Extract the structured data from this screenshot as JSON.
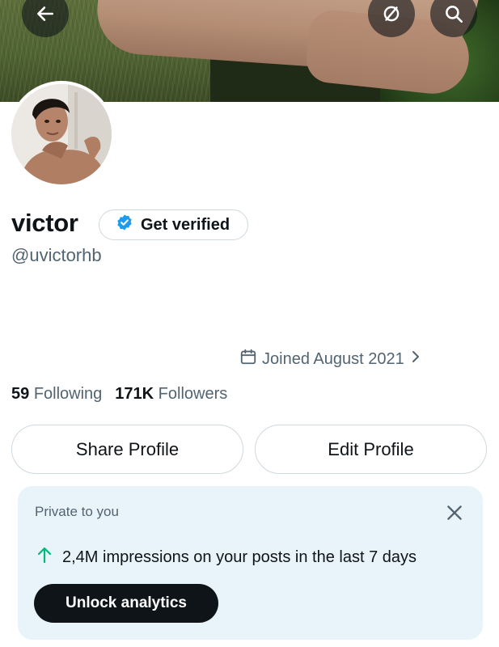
{
  "header": {
    "back_icon": "arrow-left-icon",
    "shield_icon": "circle-slash-icon",
    "search_icon": "search-icon"
  },
  "profile": {
    "display_name": "victor",
    "get_verified_label": "Get verified",
    "verified_badge_color": "#1d9bf0",
    "handle": "@uvictorhb",
    "joined": "Joined August 2021"
  },
  "stats": {
    "following_count": "59",
    "following_label": "Following",
    "followers_count": "171K",
    "followers_label": "Followers"
  },
  "actions": {
    "share_label": "Share Profile",
    "edit_label": "Edit Profile"
  },
  "analytics_card": {
    "private_label": "Private to you",
    "impressions_text": "2,4M impressions on your posts in the last 7 days",
    "unlock_label": "Unlock analytics",
    "arrow_color": "#00ba7c",
    "background": "#e9f3fa"
  }
}
